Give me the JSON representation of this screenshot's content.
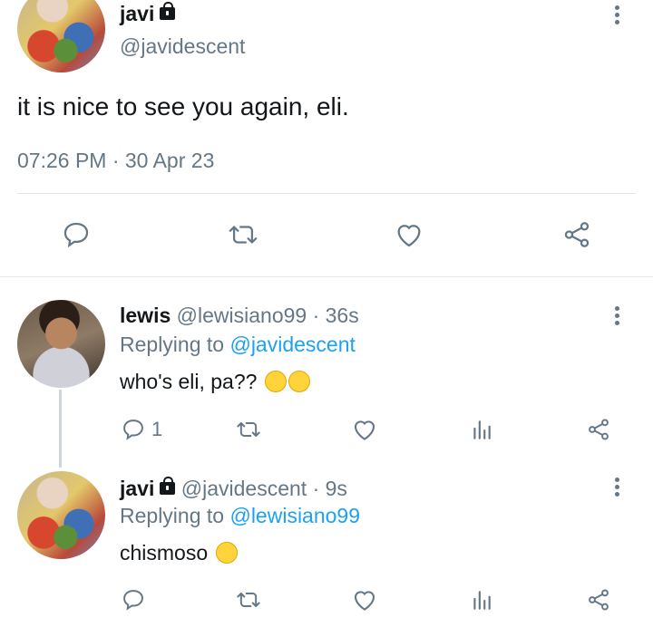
{
  "main_tweet": {
    "name": "javi",
    "handle": "@javidescent",
    "text": "it is nice to see you again, eli.",
    "timestamp": "07:26 PM · 30 Apr 23"
  },
  "reply1": {
    "name": "lewis",
    "handle_time": "@lewisiano99 · 36s",
    "replying_prefix": "Replying to",
    "replying_to": "@javidescent",
    "text": "who's eli, pa??",
    "emojis": "face-with-hand-over-mouth x2",
    "reply_count": "1"
  },
  "reply2": {
    "name": "javi",
    "handle_time": "@javidescent · 9s",
    "replying_prefix": "Replying to",
    "replying_to": "@lewisiano99",
    "text": "chismoso",
    "emoji": "face-with-rolling-eyes"
  },
  "colors": {
    "accent": "#1da1f2",
    "muted": "#657786",
    "divider": "#e1e8ed"
  }
}
